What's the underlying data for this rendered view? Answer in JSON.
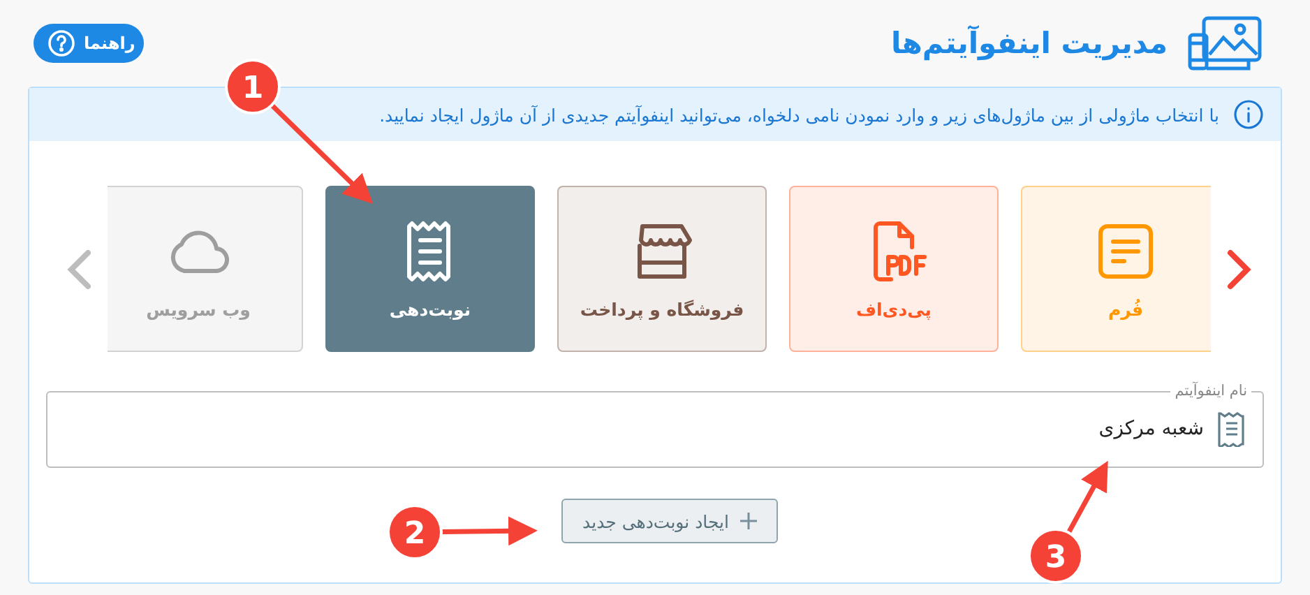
{
  "header": {
    "title": "مدیریت اینفوآیتم‌ها",
    "help_button": "راهنما"
  },
  "info": "با انتخاب ماژولی از بین ماژول‌های زیر و وارد نمودن نامی دلخواه، می‌توانید اینفوآیتم جدیدی از آن ماژول ایجاد نمایید.",
  "modules": [
    {
      "kind": "form",
      "label": "فُرم",
      "color": "#ff9800",
      "selected": false
    },
    {
      "kind": "pdf",
      "label": "پی‌دی‌اف",
      "color": "#ff5722",
      "selected": false
    },
    {
      "kind": "store",
      "label": "فروشگاه و پرداخت",
      "color": "#795548",
      "selected": false
    },
    {
      "kind": "queue",
      "label": "نوبت‌دهی",
      "color": "#607d8b",
      "selected": true
    },
    {
      "kind": "cloud",
      "label": "وب سرویس",
      "color": "#9e9e9e",
      "selected": false
    }
  ],
  "name_field": {
    "label": "نام اینفوآیتم",
    "value": "شعبه مرکزی"
  },
  "create_button": "ایجاد نوبت‌دهی جدید",
  "annotations": [
    {
      "label": "1"
    },
    {
      "label": "2"
    },
    {
      "label": "3"
    }
  ]
}
